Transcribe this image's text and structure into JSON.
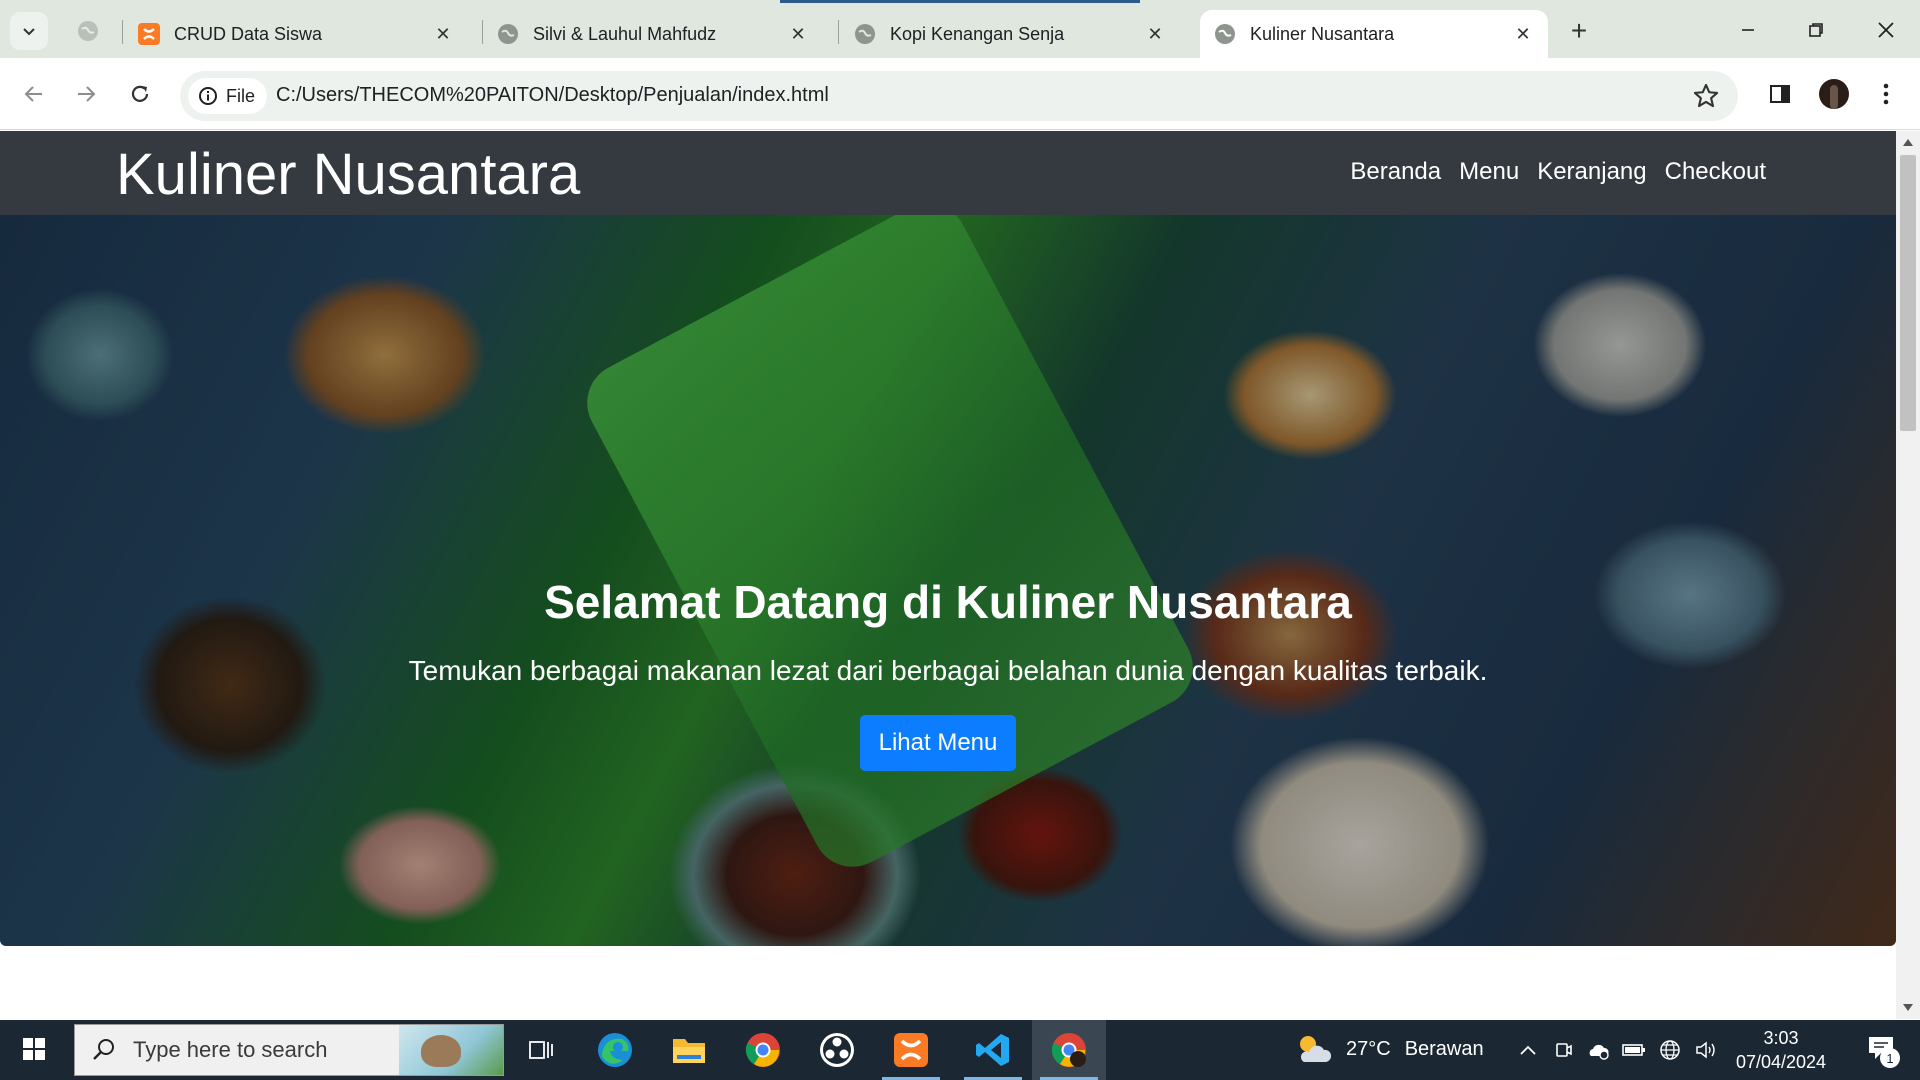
{
  "browser": {
    "tabs": [
      {
        "title": "CRUD Data Siswa",
        "favicon": "xampp-icon",
        "active": false
      },
      {
        "title": "Silvi & Lauhul Mahfudz",
        "favicon": "globe-icon",
        "active": false
      },
      {
        "title": "Kopi Kenangan Senja",
        "favicon": "globe-icon",
        "active": false
      },
      {
        "title": "Kuliner Nusantara",
        "favicon": "globe-icon",
        "active": true
      }
    ],
    "site_chip_label": "File",
    "url": "C:/Users/THECOM%20PAITON/Desktop/Penjualan/index.html"
  },
  "site": {
    "brand": "Kuliner Nusantara",
    "nav": [
      "Beranda",
      "Menu",
      "Keranjang",
      "Checkout"
    ],
    "hero": {
      "title": "Selamat Datang di Kuliner Nusantara",
      "subtitle": "Temukan berbagai makanan lezat dari berbagai belahan dunia dengan kualitas terbaik.",
      "button": "Lihat Menu"
    },
    "colors": {
      "navbar": "#343a40",
      "button": "#0d7dff"
    }
  },
  "taskbar": {
    "search_placeholder": "Type here to search",
    "weather_temp": "27°C",
    "weather_desc": "Berawan",
    "time": "3:03",
    "date": "07/04/2024",
    "notification_count": "1",
    "apps": [
      "task-view-icon",
      "edge-icon",
      "file-explorer-icon",
      "chrome-icon",
      "obs-icon",
      "xampp-icon",
      "vscode-icon",
      "chrome-profile-icon"
    ]
  }
}
